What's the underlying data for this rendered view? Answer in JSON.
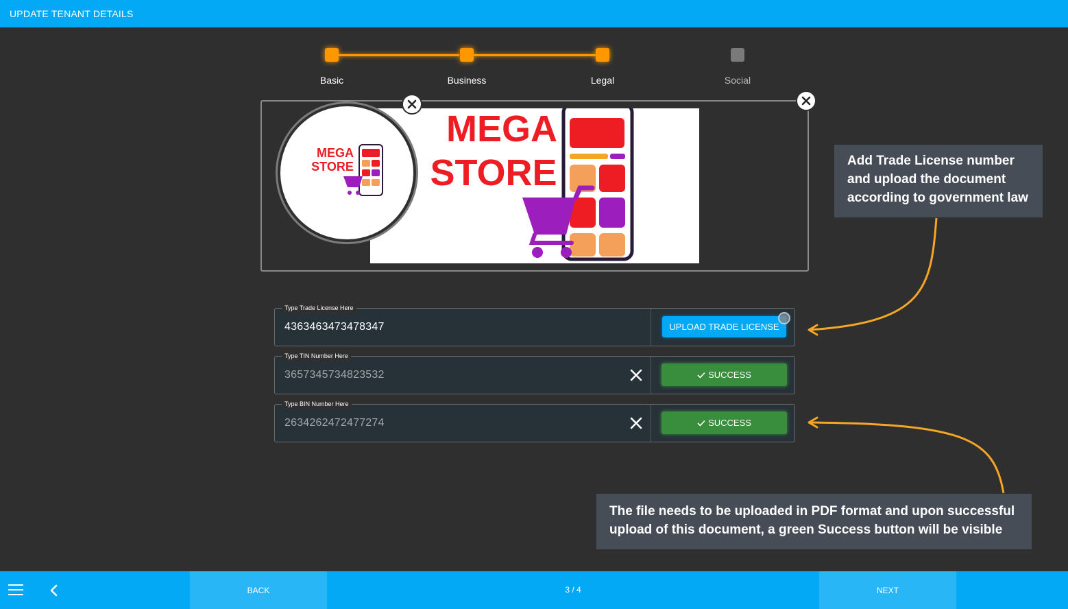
{
  "header": {
    "title": "UPDATE TENANT DETAILS"
  },
  "stepper": {
    "steps": [
      {
        "label": "Basic",
        "state": "done"
      },
      {
        "label": "Business",
        "state": "done"
      },
      {
        "label": "Legal",
        "state": "done"
      },
      {
        "label": "Social",
        "state": "pending"
      }
    ],
    "colors": {
      "done": "#ff9800",
      "pending": "#7a7a7a"
    }
  },
  "images": {
    "logo_text_line1": "MEGA",
    "logo_text_line2": "STORE",
    "banner_text_line1": "MEGA",
    "banner_text_line2": "STORE"
  },
  "fields": {
    "trade_license": {
      "label": "Type Trade License Here",
      "value": "4363463473478347",
      "button": "UPLOAD TRADE LICENSE"
    },
    "tin": {
      "label": "Type TIN Number Here",
      "value": "3657345734823532",
      "button": "SUCCESS"
    },
    "bin": {
      "label": "Type BIN Number Here",
      "value": "2634262472477274",
      "button": "SUCCESS"
    }
  },
  "callouts": {
    "trade_license": "Add Trade License number and upload the document according to government law",
    "success": "The file needs to be uploaded in PDF format and upon successful upload of this document, a green Success button will be visible"
  },
  "footer": {
    "back_label": "BACK",
    "next_label": "NEXT",
    "page_indicator": "3 / 4"
  },
  "colors": {
    "primary": "#03a9f4",
    "success": "#388e3c",
    "accent": "#ff9800",
    "background": "#2f2f2f"
  }
}
